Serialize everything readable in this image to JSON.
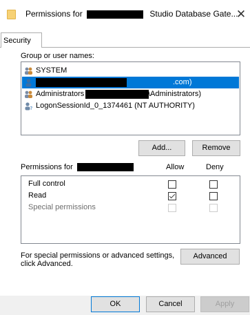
{
  "window": {
    "title_prefix": "Permissions for",
    "title_suffix": "Studio Database Gate...",
    "close_glyph": "✕"
  },
  "tabs": [
    {
      "label": "Security"
    }
  ],
  "groups": {
    "label": "Group or user names:",
    "items": [
      {
        "label": "SYSTEM",
        "icon": "users-group-icon"
      },
      {
        "label": ".com)",
        "icon": "user-icon",
        "selected": true
      },
      {
        "label": "Administrators",
        "label_suffix": "\\Administrators)",
        "icon": "users-group-icon"
      },
      {
        "label": "LogonSessionId_0_1374461 (NT AUTHORITY)",
        "icon": "user-unknown-icon"
      }
    ]
  },
  "buttons": {
    "add": "Add...",
    "remove": "Remove",
    "advanced": "Advanced",
    "ok": "OK",
    "cancel": "Cancel",
    "apply": "Apply"
  },
  "permissions": {
    "label": "Permissions for",
    "allow_header": "Allow",
    "deny_header": "Deny",
    "rows": [
      {
        "name": "Full control",
        "allow": false,
        "deny": false,
        "enabled": true
      },
      {
        "name": "Read",
        "allow": true,
        "deny": false,
        "enabled": true
      },
      {
        "name": "Special permissions",
        "allow": false,
        "deny": false,
        "enabled": false
      }
    ]
  },
  "advanced_note": {
    "line1": "For special permissions or advanced settings,",
    "line2": "click Advanced."
  },
  "colors": {
    "selection": "#0078d7",
    "button_face": "#e1e1e1",
    "folder": "#f7d276"
  }
}
